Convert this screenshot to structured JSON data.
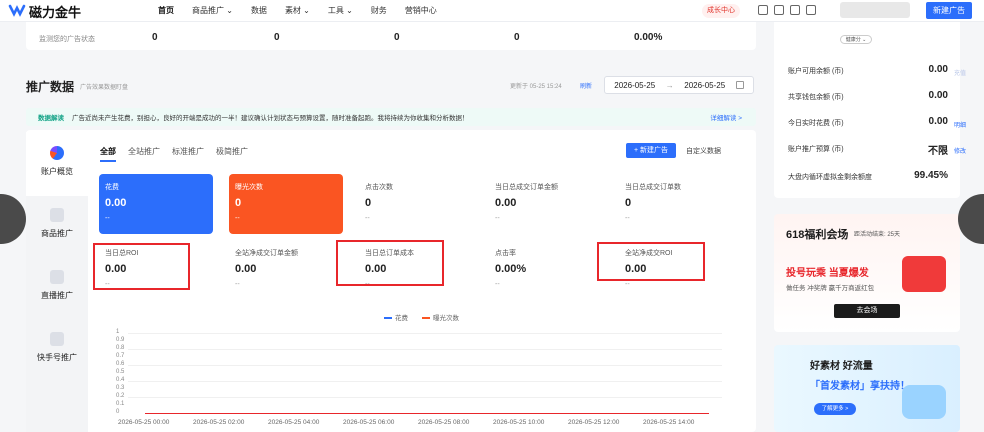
{
  "topbar": {
    "logo": "磁力金牛",
    "nav": [
      "首页",
      "商品推广 ⌄",
      "数据",
      "素材 ⌄",
      "工具 ⌄",
      "财务",
      "营销中心"
    ],
    "growth_center": "成长中心",
    "new_ad": "新建广告"
  },
  "status": {
    "subtitle": "监测您的广告状态",
    "values": [
      "0",
      "0",
      "0",
      "0",
      "0.00%"
    ]
  },
  "section": {
    "title": "推广数据",
    "subtitle": "广告效果数据盯盘",
    "updated": "更新于 05-25 15:24",
    "refresh": "刷新",
    "date_start": "2026-05-25",
    "date_sep": "→",
    "date_end": "2026-05-25"
  },
  "banner": {
    "tag": "数据解读",
    "text": "广告近尚未产生花费，别担心，良好的开端是成功的一半！建议确认计划状态与预算设置，随时准备起跑。我将持续为你收集和分析数据！",
    "link": "详细解读 >"
  },
  "side": [
    "账户概览",
    "商品推广",
    "直播推广",
    "快手号推广"
  ],
  "tabs": [
    "全部",
    "全站推广",
    "标准推广",
    "极简推广"
  ],
  "new_ad_btn": "+ 新建广告",
  "custom_data": "自定义数据",
  "metrics": [
    {
      "label": "花费",
      "value": "0.00",
      "sub": "--"
    },
    {
      "label": "曝光次数",
      "value": "0",
      "sub": "--"
    },
    {
      "label": "点击次数",
      "value": "0",
      "sub": "--"
    },
    {
      "label": "当日总成交订单金额",
      "value": "0.00",
      "sub": "--"
    },
    {
      "label": "当日总成交订单数",
      "value": "0",
      "sub": "--"
    },
    {
      "label": "当日总ROI",
      "value": "0.00",
      "sub": "--"
    },
    {
      "label": "全站净成交订单金额",
      "value": "0.00",
      "sub": "--"
    },
    {
      "label": "当日总订单成本",
      "value": "0.00",
      "sub": "--"
    },
    {
      "label": "点击率",
      "value": "0.00%",
      "sub": "--"
    },
    {
      "label": "全站净成交ROI",
      "value": "0.00",
      "sub": "--"
    }
  ],
  "chart": {
    "legend": [
      "花费",
      "曝光次数"
    ],
    "colors": {
      "spend": "#2c6efb",
      "impressions": "#fa5522"
    },
    "yticks": [
      "1",
      "0.9",
      "0.8",
      "0.7",
      "0.6",
      "0.5",
      "0.4",
      "0.3",
      "0.2",
      "0.1",
      "0"
    ],
    "xticks": [
      "2026-05-25 00:00",
      "2026-05-25 02:00",
      "2026-05-25 04:00",
      "2026-05-25 06:00",
      "2026-05-25 08:00",
      "2026-05-25 10:00",
      "2026-05-25 12:00",
      "2026-05-25 14:00"
    ]
  },
  "account": {
    "health": "健康分 ⌄",
    "rows": [
      {
        "label": "账户可用余额 (币)",
        "value": "0.00",
        "link": "充值"
      },
      {
        "label": "共享钱包余额 (币)",
        "value": "0.00",
        "link": ""
      },
      {
        "label": "今日实时花费 (币)",
        "value": "0.00",
        "link": "明细"
      },
      {
        "label": "账户推广预算 (币)",
        "value": "不限",
        "link": "修改"
      },
      {
        "label": "大盘内循环虚拟金剩余额度",
        "value": "99.45%",
        "link": ""
      }
    ]
  },
  "promo": {
    "title": "618福利会场",
    "countdown": "距活动结束: 25天",
    "headline": "投号玩乘 当夏爆发",
    "desc": "做任务 冲奖牌 赢千万商返红包",
    "button": "去会场"
  },
  "promo2": {
    "line1": "好素材 好流量",
    "line2": "「首发素材」享扶持！",
    "button": "了解更多 >"
  }
}
